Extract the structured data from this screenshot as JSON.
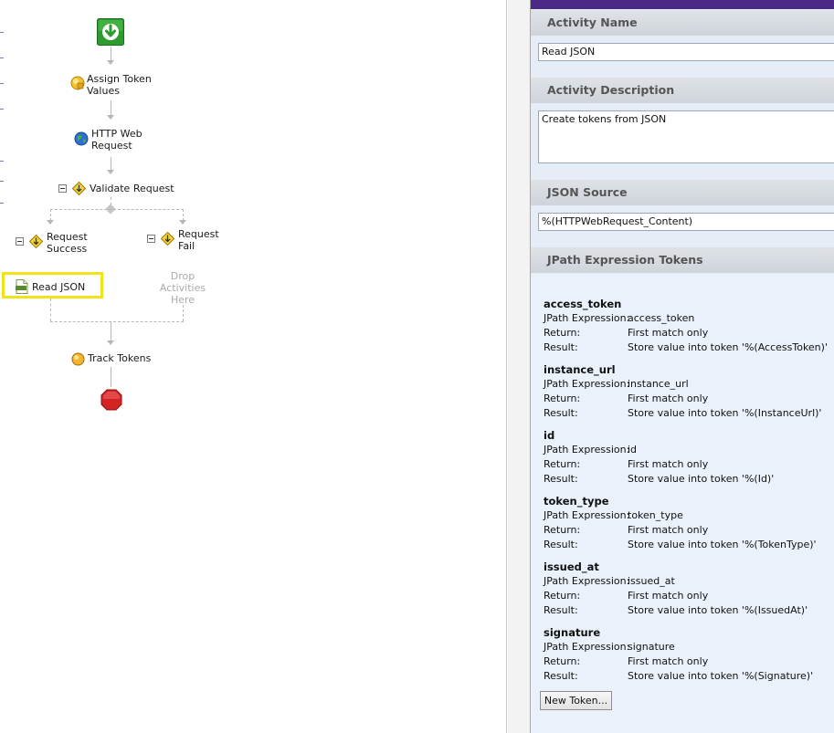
{
  "workflow": {
    "nodes": {
      "assign_token": "Assign Token Values",
      "assign_token_line1": "Assign Token",
      "assign_token_line2": "Values",
      "http_line1": "HTTP Web",
      "http_line2": "Request",
      "validate": "Validate Request",
      "success_line1": "Request",
      "success_line2": "Success",
      "fail_line1": "Request",
      "fail_line2": "Fail",
      "drop_line1": "Drop",
      "drop_line2": "Activities",
      "drop_line3": "Here",
      "read_json": "Read JSON",
      "track_tokens": "Track Tokens"
    },
    "colors": {
      "start": "#2e9b2e",
      "stop": "#d42323",
      "highlight": "#f2e21b"
    }
  },
  "panel": {
    "activity_name_label": "Activity Name",
    "activity_name_value": "Read JSON",
    "activity_description_label": "Activity Description",
    "activity_description_value": "Create tokens from JSON",
    "json_source_label": "JSON Source",
    "json_source_value": "%(HTTPWebRequest_Content)",
    "jpath_label": "JPath Expression Tokens",
    "row_labels": {
      "expr": "JPath Expression:",
      "ret": "Return:",
      "res": "Result:"
    },
    "tokens": [
      {
        "name": "access_token",
        "expr": "access_token",
        "ret": "First match only",
        "res": "Store value into token '%(AccessToken)'"
      },
      {
        "name": "instance_url",
        "expr": "instance_url",
        "ret": "First match only",
        "res": "Store value into token '%(InstanceUrl)'"
      },
      {
        "name": "id",
        "expr": "id",
        "ret": "First match only",
        "res": "Store value into token '%(Id)'"
      },
      {
        "name": "token_type",
        "expr": "token_type",
        "ret": "First match only",
        "res": "Store value into token '%(TokenType)'"
      },
      {
        "name": "issued_at",
        "expr": "issued_at",
        "ret": "First match only",
        "res": "Store value into token '%(IssuedAt)'"
      },
      {
        "name": "signature",
        "expr": "signature",
        "ret": "First match only",
        "res": "Store value into token '%(Signature)'"
      }
    ],
    "new_token_button": "New Token..."
  }
}
